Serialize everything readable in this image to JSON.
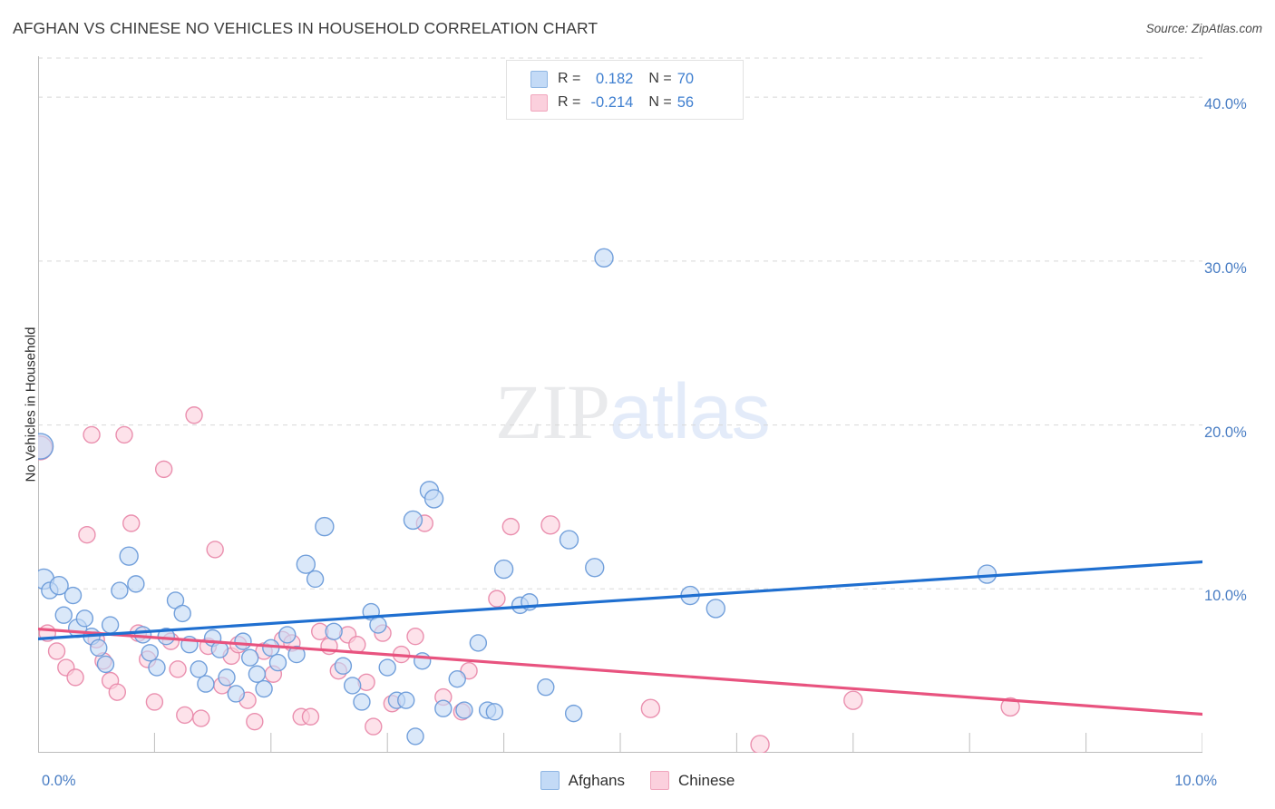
{
  "header": {
    "title": "AFGHAN VS CHINESE NO VEHICLES IN HOUSEHOLD CORRELATION CHART",
    "source": "Source: ZipAtlas.com"
  },
  "watermark": {
    "part1": "ZIP",
    "part2": "atlas"
  },
  "stats": {
    "rows": [
      {
        "series": "Afghans",
        "color": "#c3daf6",
        "r_label": "R =",
        "r_value": "0.182",
        "n_label": "N =",
        "n_value": "70"
      },
      {
        "series": "Chinese",
        "color": "#fbd0dd",
        "r_label": "R =",
        "r_value": "-0.214",
        "n_label": "N =",
        "n_value": "56"
      }
    ]
  },
  "legend": {
    "items": [
      {
        "label": "Afghans",
        "color": "#c3daf6"
      },
      {
        "label": "Chinese",
        "color": "#fbd0dd"
      }
    ]
  },
  "axes": {
    "y_title": "No Vehicles in Household",
    "y_ticks": [
      {
        "label": "40.0%",
        "value": 40
      },
      {
        "label": "30.0%",
        "value": 30
      },
      {
        "label": "20.0%",
        "value": 20
      },
      {
        "label": "10.0%",
        "value": 10
      }
    ],
    "x_ticks": [
      {
        "label": "0.0%",
        "value": 0
      },
      {
        "label": "10.0%",
        "value": 10
      }
    ]
  },
  "chart_data": {
    "type": "scatter",
    "title": "AFGHAN VS CHINESE NO VEHICLES IN HOUSEHOLD CORRELATION CHART",
    "xlabel": "",
    "ylabel": "No Vehicles in Household",
    "xlim": [
      0,
      10
    ],
    "ylim": [
      0,
      42.5
    ],
    "grid": "horizontal-dashed",
    "legend_position": "bottom-center",
    "x_unit": "%",
    "y_unit": "%",
    "series": [
      {
        "name": "Afghans",
        "color": "#c3daf6",
        "stroke": "#6b9bd9",
        "r": 0.182,
        "n": 70,
        "trendline": {
          "x0": 0.0,
          "y0": 6.95,
          "x1": 10.0,
          "y1": 11.65
        },
        "points": [
          {
            "x": 0.02,
            "y": 18.7,
            "r": 14
          },
          {
            "x": 0.05,
            "y": 10.6,
            "r": 11
          },
          {
            "x": 0.1,
            "y": 9.9,
            "r": 9
          },
          {
            "x": 0.18,
            "y": 10.2,
            "r": 10
          },
          {
            "x": 0.22,
            "y": 8.4,
            "r": 9
          },
          {
            "x": 0.3,
            "y": 9.6,
            "r": 9
          },
          {
            "x": 0.34,
            "y": 7.6,
            "r": 10
          },
          {
            "x": 0.4,
            "y": 8.2,
            "r": 9
          },
          {
            "x": 0.46,
            "y": 7.1,
            "r": 9
          },
          {
            "x": 0.52,
            "y": 6.4,
            "r": 9
          },
          {
            "x": 0.58,
            "y": 5.4,
            "r": 9
          },
          {
            "x": 0.62,
            "y": 7.8,
            "r": 9
          },
          {
            "x": 0.7,
            "y": 9.9,
            "r": 9
          },
          {
            "x": 0.78,
            "y": 12.0,
            "r": 10
          },
          {
            "x": 0.84,
            "y": 10.3,
            "r": 9
          },
          {
            "x": 0.9,
            "y": 7.2,
            "r": 9
          },
          {
            "x": 0.96,
            "y": 6.1,
            "r": 9
          },
          {
            "x": 1.02,
            "y": 5.2,
            "r": 9
          },
          {
            "x": 1.1,
            "y": 7.1,
            "r": 9
          },
          {
            "x": 1.18,
            "y": 9.3,
            "r": 9
          },
          {
            "x": 1.24,
            "y": 8.5,
            "r": 9
          },
          {
            "x": 1.3,
            "y": 6.6,
            "r": 9
          },
          {
            "x": 1.38,
            "y": 5.1,
            "r": 9
          },
          {
            "x": 1.44,
            "y": 4.2,
            "r": 9
          },
          {
            "x": 1.5,
            "y": 7.0,
            "r": 9
          },
          {
            "x": 1.56,
            "y": 6.3,
            "r": 9
          },
          {
            "x": 1.62,
            "y": 4.6,
            "r": 9
          },
          {
            "x": 1.7,
            "y": 3.6,
            "r": 9
          },
          {
            "x": 1.76,
            "y": 6.8,
            "r": 9
          },
          {
            "x": 1.82,
            "y": 5.8,
            "r": 9
          },
          {
            "x": 1.88,
            "y": 4.8,
            "r": 9
          },
          {
            "x": 1.94,
            "y": 3.9,
            "r": 9
          },
          {
            "x": 2.0,
            "y": 6.4,
            "r": 9
          },
          {
            "x": 2.06,
            "y": 5.5,
            "r": 9
          },
          {
            "x": 2.14,
            "y": 7.2,
            "r": 9
          },
          {
            "x": 2.22,
            "y": 6.0,
            "r": 9
          },
          {
            "x": 2.3,
            "y": 11.5,
            "r": 10
          },
          {
            "x": 2.38,
            "y": 10.6,
            "r": 9
          },
          {
            "x": 2.46,
            "y": 13.8,
            "r": 10
          },
          {
            "x": 2.54,
            "y": 7.4,
            "r": 9
          },
          {
            "x": 2.62,
            "y": 5.3,
            "r": 9
          },
          {
            "x": 2.7,
            "y": 4.1,
            "r": 9
          },
          {
            "x": 2.78,
            "y": 3.1,
            "r": 9
          },
          {
            "x": 2.86,
            "y": 8.6,
            "r": 9
          },
          {
            "x": 2.92,
            "y": 7.8,
            "r": 9
          },
          {
            "x": 3.0,
            "y": 5.2,
            "r": 9
          },
          {
            "x": 3.08,
            "y": 3.2,
            "r": 9
          },
          {
            "x": 3.16,
            "y": 3.2,
            "r": 9
          },
          {
            "x": 3.24,
            "y": 1.0,
            "r": 9
          },
          {
            "x": 3.3,
            "y": 5.6,
            "r": 9
          },
          {
            "x": 3.36,
            "y": 16.0,
            "r": 10
          },
          {
            "x": 3.4,
            "y": 15.5,
            "r": 10
          },
          {
            "x": 3.22,
            "y": 14.2,
            "r": 10
          },
          {
            "x": 3.48,
            "y": 2.7,
            "r": 9
          },
          {
            "x": 3.6,
            "y": 4.5,
            "r": 9
          },
          {
            "x": 3.66,
            "y": 2.6,
            "r": 9
          },
          {
            "x": 3.78,
            "y": 6.7,
            "r": 9
          },
          {
            "x": 3.86,
            "y": 2.6,
            "r": 9
          },
          {
            "x": 3.92,
            "y": 2.5,
            "r": 9
          },
          {
            "x": 4.0,
            "y": 11.2,
            "r": 10
          },
          {
            "x": 4.14,
            "y": 9.0,
            "r": 9
          },
          {
            "x": 4.22,
            "y": 9.2,
            "r": 9
          },
          {
            "x": 4.36,
            "y": 4.0,
            "r": 9
          },
          {
            "x": 4.56,
            "y": 13.0,
            "r": 10
          },
          {
            "x": 4.6,
            "y": 2.4,
            "r": 9
          },
          {
            "x": 4.78,
            "y": 11.3,
            "r": 10
          },
          {
            "x": 4.86,
            "y": 30.2,
            "r": 10
          },
          {
            "x": 5.6,
            "y": 9.6,
            "r": 10
          },
          {
            "x": 5.82,
            "y": 8.8,
            "r": 10
          },
          {
            "x": 8.15,
            "y": 10.9,
            "r": 10
          }
        ]
      },
      {
        "name": "Chinese",
        "color": "#fbd0dd",
        "stroke": "#e98aab",
        "r": -0.214,
        "n": 56,
        "trendline": {
          "x0": 0.0,
          "y0": 7.55,
          "x1": 10.0,
          "y1": 2.35
        },
        "points": [
          {
            "x": 0.02,
            "y": 18.6,
            "r": 13
          },
          {
            "x": 0.08,
            "y": 7.3,
            "r": 9
          },
          {
            "x": 0.16,
            "y": 6.2,
            "r": 9
          },
          {
            "x": 0.24,
            "y": 5.2,
            "r": 9
          },
          {
            "x": 0.32,
            "y": 4.6,
            "r": 9
          },
          {
            "x": 0.42,
            "y": 13.3,
            "r": 9
          },
          {
            "x": 0.46,
            "y": 19.4,
            "r": 9
          },
          {
            "x": 0.5,
            "y": 6.9,
            "r": 9
          },
          {
            "x": 0.56,
            "y": 5.6,
            "r": 9
          },
          {
            "x": 0.62,
            "y": 4.4,
            "r": 9
          },
          {
            "x": 0.68,
            "y": 3.7,
            "r": 9
          },
          {
            "x": 0.74,
            "y": 19.4,
            "r": 9
          },
          {
            "x": 0.8,
            "y": 14.0,
            "r": 9
          },
          {
            "x": 0.86,
            "y": 7.3,
            "r": 9
          },
          {
            "x": 0.94,
            "y": 5.7,
            "r": 9
          },
          {
            "x": 1.0,
            "y": 3.1,
            "r": 9
          },
          {
            "x": 1.08,
            "y": 17.3,
            "r": 9
          },
          {
            "x": 1.14,
            "y": 6.8,
            "r": 9
          },
          {
            "x": 1.2,
            "y": 5.1,
            "r": 9
          },
          {
            "x": 1.26,
            "y": 2.3,
            "r": 9
          },
          {
            "x": 1.34,
            "y": 20.6,
            "r": 9
          },
          {
            "x": 1.4,
            "y": 2.1,
            "r": 9
          },
          {
            "x": 1.46,
            "y": 6.5,
            "r": 9
          },
          {
            "x": 1.52,
            "y": 12.4,
            "r": 9
          },
          {
            "x": 1.58,
            "y": 4.1,
            "r": 9
          },
          {
            "x": 1.66,
            "y": 5.9,
            "r": 9
          },
          {
            "x": 1.72,
            "y": 6.6,
            "r": 9
          },
          {
            "x": 1.8,
            "y": 3.2,
            "r": 9
          },
          {
            "x": 1.86,
            "y": 1.9,
            "r": 9
          },
          {
            "x": 1.94,
            "y": 6.2,
            "r": 9
          },
          {
            "x": 2.02,
            "y": 4.8,
            "r": 9
          },
          {
            "x": 2.1,
            "y": 6.9,
            "r": 9
          },
          {
            "x": 2.18,
            "y": 6.7,
            "r": 9
          },
          {
            "x": 2.26,
            "y": 2.2,
            "r": 9
          },
          {
            "x": 2.34,
            "y": 2.2,
            "r": 9
          },
          {
            "x": 2.42,
            "y": 7.4,
            "r": 9
          },
          {
            "x": 2.5,
            "y": 6.5,
            "r": 9
          },
          {
            "x": 2.58,
            "y": 5.0,
            "r": 9
          },
          {
            "x": 2.66,
            "y": 7.2,
            "r": 9
          },
          {
            "x": 2.74,
            "y": 6.6,
            "r": 9
          },
          {
            "x": 2.82,
            "y": 4.3,
            "r": 9
          },
          {
            "x": 2.88,
            "y": 1.6,
            "r": 9
          },
          {
            "x": 2.96,
            "y": 7.3,
            "r": 9
          },
          {
            "x": 3.04,
            "y": 3.0,
            "r": 9
          },
          {
            "x": 3.12,
            "y": 6.0,
            "r": 9
          },
          {
            "x": 3.24,
            "y": 7.1,
            "r": 9
          },
          {
            "x": 3.32,
            "y": 14.0,
            "r": 9
          },
          {
            "x": 3.48,
            "y": 3.4,
            "r": 9
          },
          {
            "x": 3.64,
            "y": 2.5,
            "r": 9
          },
          {
            "x": 3.7,
            "y": 5.0,
            "r": 9
          },
          {
            "x": 3.94,
            "y": 9.4,
            "r": 9
          },
          {
            "x": 4.06,
            "y": 13.8,
            "r": 9
          },
          {
            "x": 4.4,
            "y": 13.9,
            "r": 10
          },
          {
            "x": 5.26,
            "y": 2.7,
            "r": 10
          },
          {
            "x": 6.2,
            "y": 0.5,
            "r": 10
          },
          {
            "x": 7.0,
            "y": 3.2,
            "r": 10
          },
          {
            "x": 8.35,
            "y": 2.8,
            "r": 10
          }
        ]
      }
    ]
  }
}
